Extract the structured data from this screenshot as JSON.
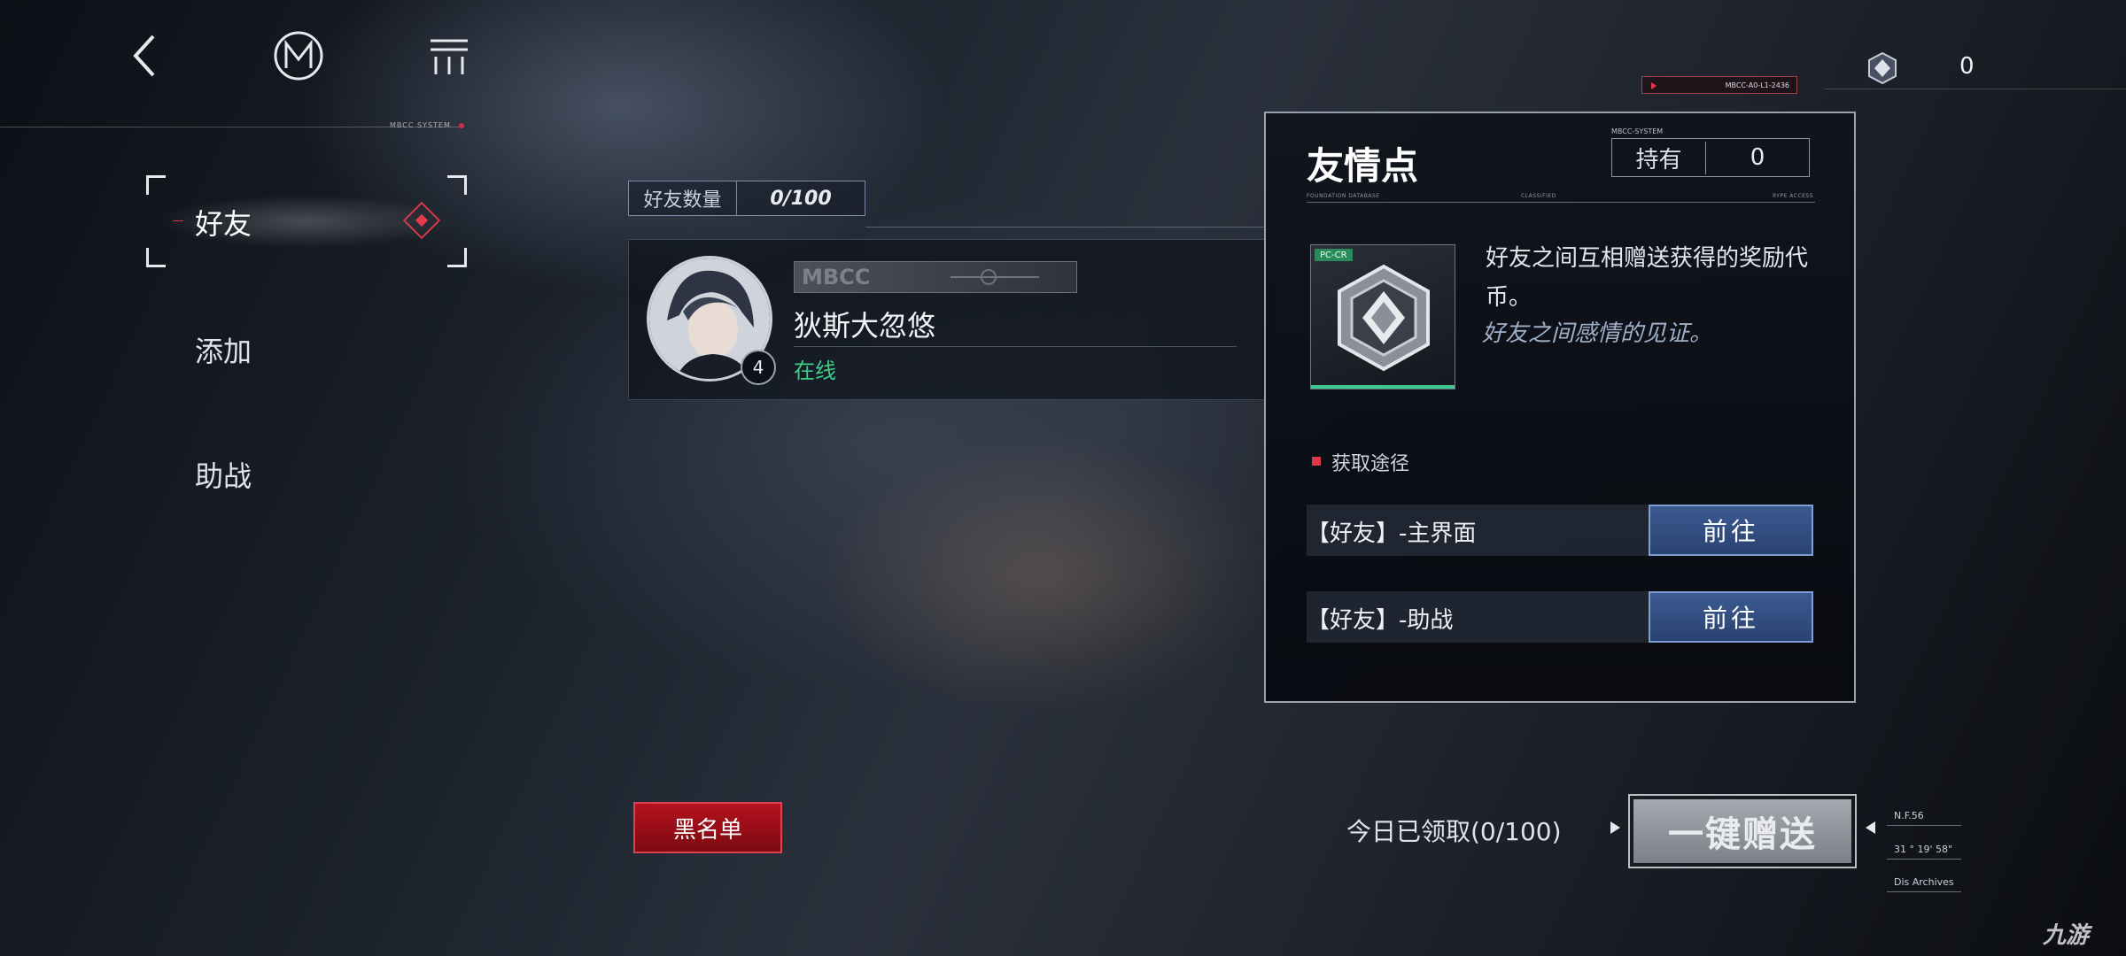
{
  "nav": {
    "back_icon": "back-arrow-icon",
    "logo_icon": "mbcc-logo-icon",
    "menu_icon": "menu-icon",
    "system_label": "MBCC SYSTEM"
  },
  "sidebar": {
    "items": [
      {
        "label": "好友",
        "active": true
      },
      {
        "label": "添加",
        "active": false
      },
      {
        "label": "助战",
        "active": false
      }
    ]
  },
  "friends": {
    "count_label": "好友数量",
    "count_value": "0/100",
    "list": [
      {
        "tag": "MBCC",
        "name": "狄斯大忽悠",
        "status": "在线",
        "level": "4"
      }
    ]
  },
  "currency": {
    "icon": "friendship-point-icon",
    "value": "0",
    "tag_text": "MBCC-A0-L1-2436"
  },
  "popup": {
    "title": "友情点",
    "system_label": "MBCC-SYSTEM",
    "hold_label": "持有",
    "hold_value": "0",
    "rule_left": "FOUNDATION DATABASE",
    "rule_mid": "CLASSIFIED",
    "rule_right": "RYPE ACCESS",
    "item_tag": "PC-CR",
    "description": "好友之间互相赠送获得的奖励代币。",
    "flavor": "好友之间感情的见证。",
    "acquire_label": "获取途径",
    "routes": [
      {
        "label": "【好友】-主界面",
        "button": "前往"
      },
      {
        "label": "【好友】-助战",
        "button": "前往"
      }
    ]
  },
  "bottom": {
    "blacklist": "黑名单",
    "received": "今日已领取(0/100)",
    "send_all": "一键赠送",
    "coord_1": "N.F.56",
    "coord_2": "31 ° 19' 58\"",
    "coord_3": "Dis Archives"
  },
  "watermark": "九游",
  "colors": {
    "accent_red": "#e03848",
    "online_green": "#3fcf8a",
    "go_button_blue": "#3c5a90"
  }
}
